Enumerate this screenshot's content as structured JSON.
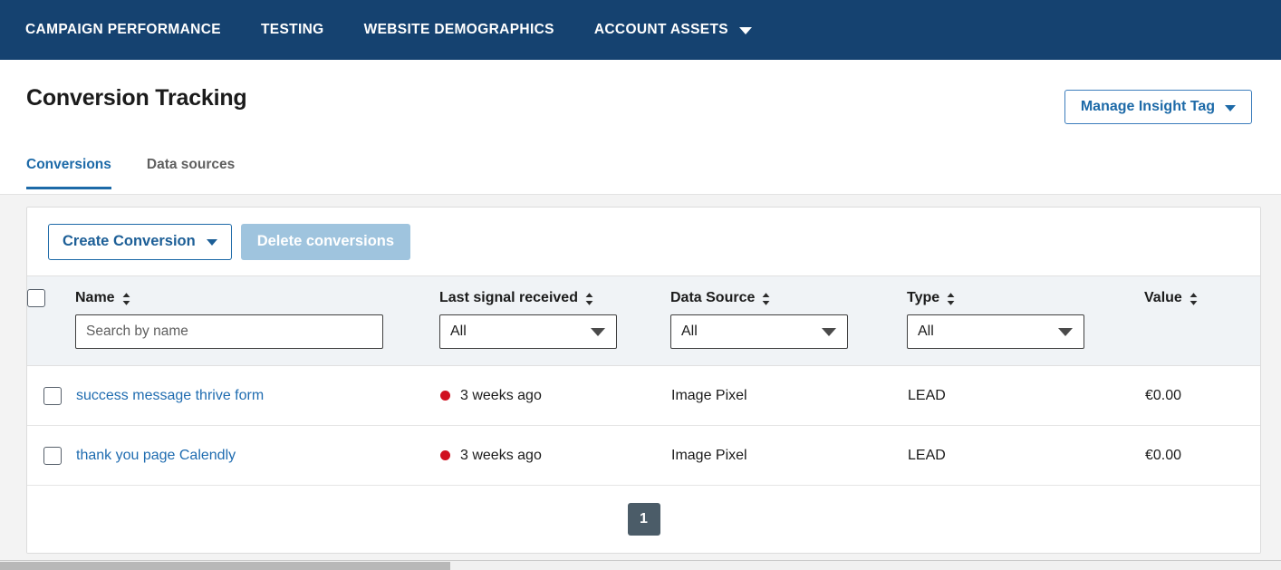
{
  "topnav": {
    "items": [
      {
        "label": "CAMPAIGN PERFORMANCE",
        "has_caret": false
      },
      {
        "label": "TESTING",
        "has_caret": false
      },
      {
        "label": "WEBSITE DEMOGRAPHICS",
        "has_caret": false
      },
      {
        "label": "ACCOUNT ASSETS",
        "has_caret": true
      }
    ],
    "background_color": "#154270"
  },
  "header": {
    "title": "Conversion Tracking",
    "manage_button_label": "Manage Insight Tag",
    "accent_color": "#1d6aa8"
  },
  "tabs": [
    {
      "label": "Conversions",
      "active": true
    },
    {
      "label": "Data sources",
      "active": false
    }
  ],
  "toolbar": {
    "create_label": "Create Conversion",
    "delete_label": "Delete conversions",
    "delete_disabled_color": "#9fc4de"
  },
  "table": {
    "columns": [
      {
        "key": "check",
        "label": "",
        "sortable": false
      },
      {
        "key": "name",
        "label": "Name",
        "sortable": true
      },
      {
        "key": "last",
        "label": "Last signal received",
        "sortable": true
      },
      {
        "key": "source",
        "label": "Data Source",
        "sortable": true
      },
      {
        "key": "type",
        "label": "Type",
        "sortable": true
      },
      {
        "key": "value",
        "label": "Value",
        "sortable": true
      }
    ],
    "filters": {
      "name_placeholder": "Search by name",
      "name_value": "",
      "last_signal_selected": "All",
      "data_source_selected": "All",
      "type_selected": "All"
    },
    "rows": [
      {
        "name": "success message thrive form",
        "last_signal": "3 weeks ago",
        "status_color": "#d0101f",
        "data_source": "Image Pixel",
        "type": "LEAD",
        "value": "€0.00",
        "checked": false
      },
      {
        "name": "thank you page Calendly",
        "last_signal": "3 weeks ago",
        "status_color": "#d0101f",
        "data_source": "Image Pixel",
        "type": "LEAD",
        "value": "€0.00",
        "checked": false
      }
    ]
  },
  "pagination": {
    "current_page": "1"
  }
}
